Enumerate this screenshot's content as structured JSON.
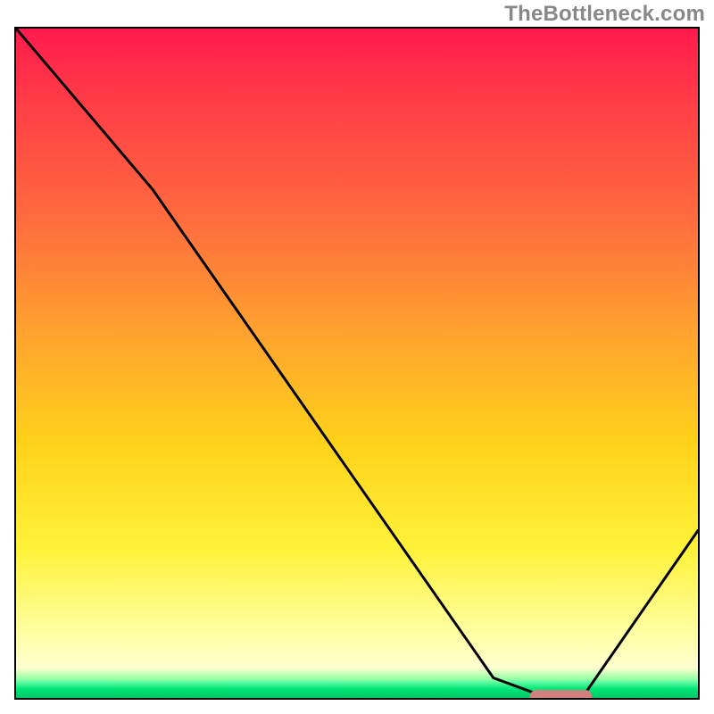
{
  "watermark": "TheBottleneck.com",
  "chart_data": {
    "type": "line",
    "title": "",
    "xlabel": "",
    "ylabel": "",
    "xlim": [
      0,
      100
    ],
    "ylim": [
      0,
      100
    ],
    "grid": false,
    "legend": false,
    "background": "red-to-green vertical gradient (bottleneck severity scale)",
    "series": [
      {
        "name": "bottleneck-curve",
        "x": [
          0,
          20,
          70,
          78,
          83,
          100
        ],
        "y": [
          100,
          76,
          3,
          0,
          0,
          25
        ]
      }
    ],
    "optimal_range": {
      "x_start": 75,
      "x_end": 84,
      "y": 0.8
    },
    "colors": {
      "curve": "#000000",
      "marker": "#d18080",
      "gradient_top": "#ff1a4d",
      "gradient_bottom": "#00e676"
    }
  }
}
